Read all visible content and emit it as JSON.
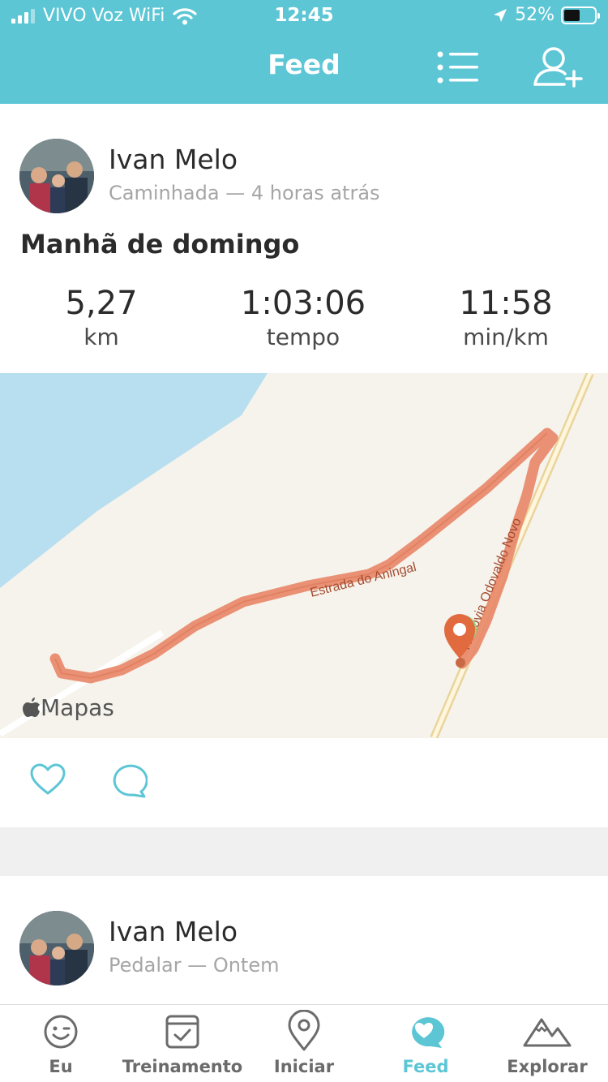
{
  "status_bar": {
    "carrier": "VIVO Voz WiFi",
    "time": "12:45",
    "battery": "52%"
  },
  "header": {
    "title": "Feed",
    "icons": [
      "list-icon",
      "add-user-icon"
    ]
  },
  "feed": [
    {
      "user": "Ivan Melo",
      "subtitle": "Caminhada — 4 horas atrás",
      "title": "Manhã de domingo",
      "stats": [
        {
          "value": "5,27",
          "unit": "km"
        },
        {
          "value": "1:03:06",
          "unit": "tempo"
        },
        {
          "value": "11:58",
          "unit": "min/km"
        }
      ],
      "map": {
        "attribution": "Mapas",
        "road_labels": [
          "Estrada do Aningal",
          "Rodovia Odovaldo Novo"
        ]
      },
      "actions": [
        "heart-icon",
        "comment-icon"
      ]
    },
    {
      "user": "Ivan Melo",
      "subtitle": "Pedalar — Ontem"
    }
  ],
  "tabbar": {
    "items": [
      {
        "label": "Eu",
        "icon": "smile-icon",
        "active": false
      },
      {
        "label": "Treinamento",
        "icon": "checklist-icon",
        "active": false
      },
      {
        "label": "Iniciar",
        "icon": "location-pin-icon",
        "active": false
      },
      {
        "label": "Feed",
        "icon": "feed-heart-icon",
        "active": true
      },
      {
        "label": "Explorar",
        "icon": "mountains-icon",
        "active": false
      }
    ]
  },
  "colors": {
    "accent": "#5cc6d5",
    "route": "#e8896a",
    "water": "#b8dff0",
    "marker": "#e26a3f",
    "start_marker": "#8fd67e"
  }
}
